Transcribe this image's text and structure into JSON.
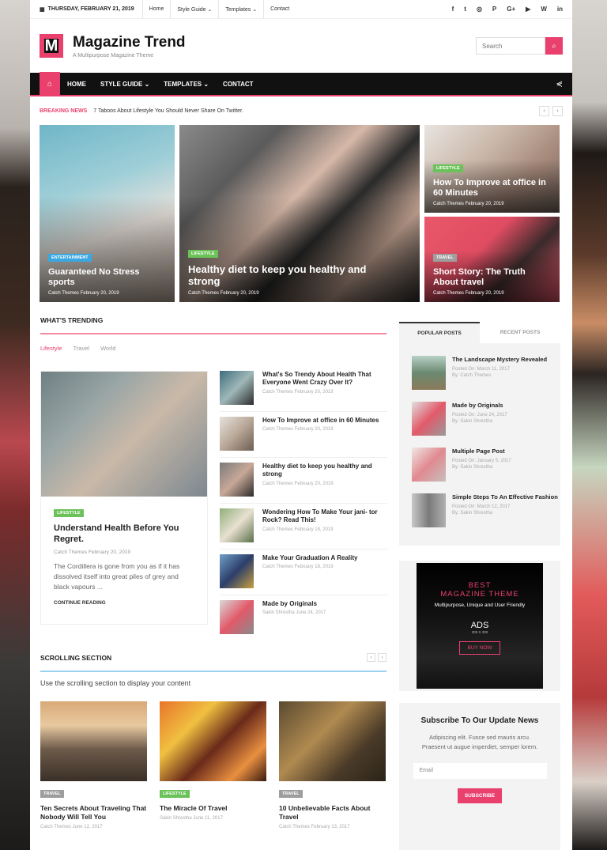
{
  "topbar": {
    "date": "THURSDAY, FEBRUARY 21, 2019",
    "links": [
      "Home",
      "Style Guide ⌄",
      "Templates ⌄",
      "Contact"
    ],
    "social": [
      "f",
      "t",
      "ig",
      "p",
      "g+",
      "yt",
      "wp",
      "in"
    ]
  },
  "header": {
    "logo_letter": "M",
    "title": "Magazine Trend",
    "tagline": "A Multipurpose Magazine Theme",
    "search_placeholder": "Search"
  },
  "nav": {
    "items": [
      "HOME",
      "STYLE GUIDE ⌄",
      "TEMPLATES ⌄",
      "CONTACT"
    ]
  },
  "breaking": {
    "label": "BREAKING NEWS",
    "text": "7 Taboos About Lifestyle You Should Never Share On Twitter."
  },
  "hero": [
    {
      "cat": "ENTERTAINMENT",
      "title": "Guaranteed No Stress sports",
      "meta": "Catch Themes February 20, 2019"
    },
    {
      "cat": "LIFESTYLE",
      "title": "Healthy diet to keep you healthy and strong",
      "meta": "Catch Themes February 20, 2019"
    },
    {
      "cat": "LIFESTYLE",
      "title": "How To Improve at office in 60 Minutes",
      "meta": "Catch Themes February 20, 2019"
    },
    {
      "cat": "TRAVEL",
      "title": "Short Story: The Truth About travel",
      "meta": "Catch Themes February 20, 2019"
    }
  ],
  "trending": {
    "title": "WHAT'S TRENDING",
    "tabs": [
      "Lifestyle",
      "Travel",
      "World"
    ],
    "featured": {
      "cat": "LIFESTYLE",
      "title": "Understand Health Before You Regret.",
      "meta": "Catch Themes February 20, 2019",
      "excerpt": "The Cordillera is gone from you as if it has dissolved itself into great piles of grey and black vapours ...",
      "cta": "CONTINUE READING"
    },
    "list": [
      {
        "title": "What's So Trendy About Health That Everyone Went Crazy Over It?",
        "meta": "Catch Themes February 20, 2019"
      },
      {
        "title": "How To Improve at office in 60 Minutes",
        "meta": "Catch Themes February 20, 2019"
      },
      {
        "title": "Healthy diet to keep you healthy and strong",
        "meta": "Catch Themes February 20, 2019"
      },
      {
        "title": "Wondering How To Make Your jani- tor Rock? Read This!",
        "meta": "Catch Themes February 18, 2019"
      },
      {
        "title": "Make Your Graduation A Reality",
        "meta": "Catch Themes February 18, 2019"
      },
      {
        "title": "Made by Originals",
        "meta": "Sakin Shrestha June 24, 2017"
      }
    ]
  },
  "scrolling": {
    "title": "SCROLLING SECTION",
    "subtitle": "Use the scrolling section to display your content",
    "items": [
      {
        "cat": "TRAVEL",
        "title": "Ten Secrets About Traveling That Nobody Will Tell You",
        "meta": "Catch Themes June 12, 2017"
      },
      {
        "cat": "LIFESTYLE",
        "title": "The Miracle Of Travel",
        "meta": "Sakin Shrestha June 11, 2017"
      },
      {
        "cat": "TRAVEL",
        "title": "10 Unbelievable Facts About Travel",
        "meta": "Catch Themes February 13, 2017"
      }
    ]
  },
  "sidebar": {
    "tabs": [
      "POPULAR POSTS",
      "RECENT POSTS"
    ],
    "posts": [
      {
        "title": "The Landscape Mystery Revealed",
        "date": "Posted On: March 11, 2017",
        "by": "By: Catch Themes"
      },
      {
        "title": "Made by Originals",
        "date": "Posted On: June 24, 2017",
        "by": "By: Sakin Shrestha"
      },
      {
        "title": "Multiple Page Post",
        "date": "Posted On: January 5, 2017",
        "by": "By: Sakin Shrestha"
      },
      {
        "title": "Simple Steps To An Effective Fashion",
        "date": "Posted On: March 12, 2017",
        "by": "By: Sakin Shrestha"
      }
    ],
    "ad": {
      "l1": "BEST",
      "l2": "MAGAZINE THEME",
      "l3": "Multipurpose, Unique and User Friendly",
      "l4": "ADS",
      "l5": "300 X 300",
      "btn": "BUY NOW"
    },
    "subscribe": {
      "title": "Subscribe To Our Update News",
      "text": "Adipiscing elit. Fusce sed mauris arcu. Praesent ut augue imperdiet, semper lorem.",
      "email_placeholder": "Email",
      "btn": "SUBSCRIBE"
    }
  },
  "colors": {
    "accent": "#e9406e",
    "green_badge": "#6bc259",
    "blue_badge": "#3aa7e0"
  }
}
